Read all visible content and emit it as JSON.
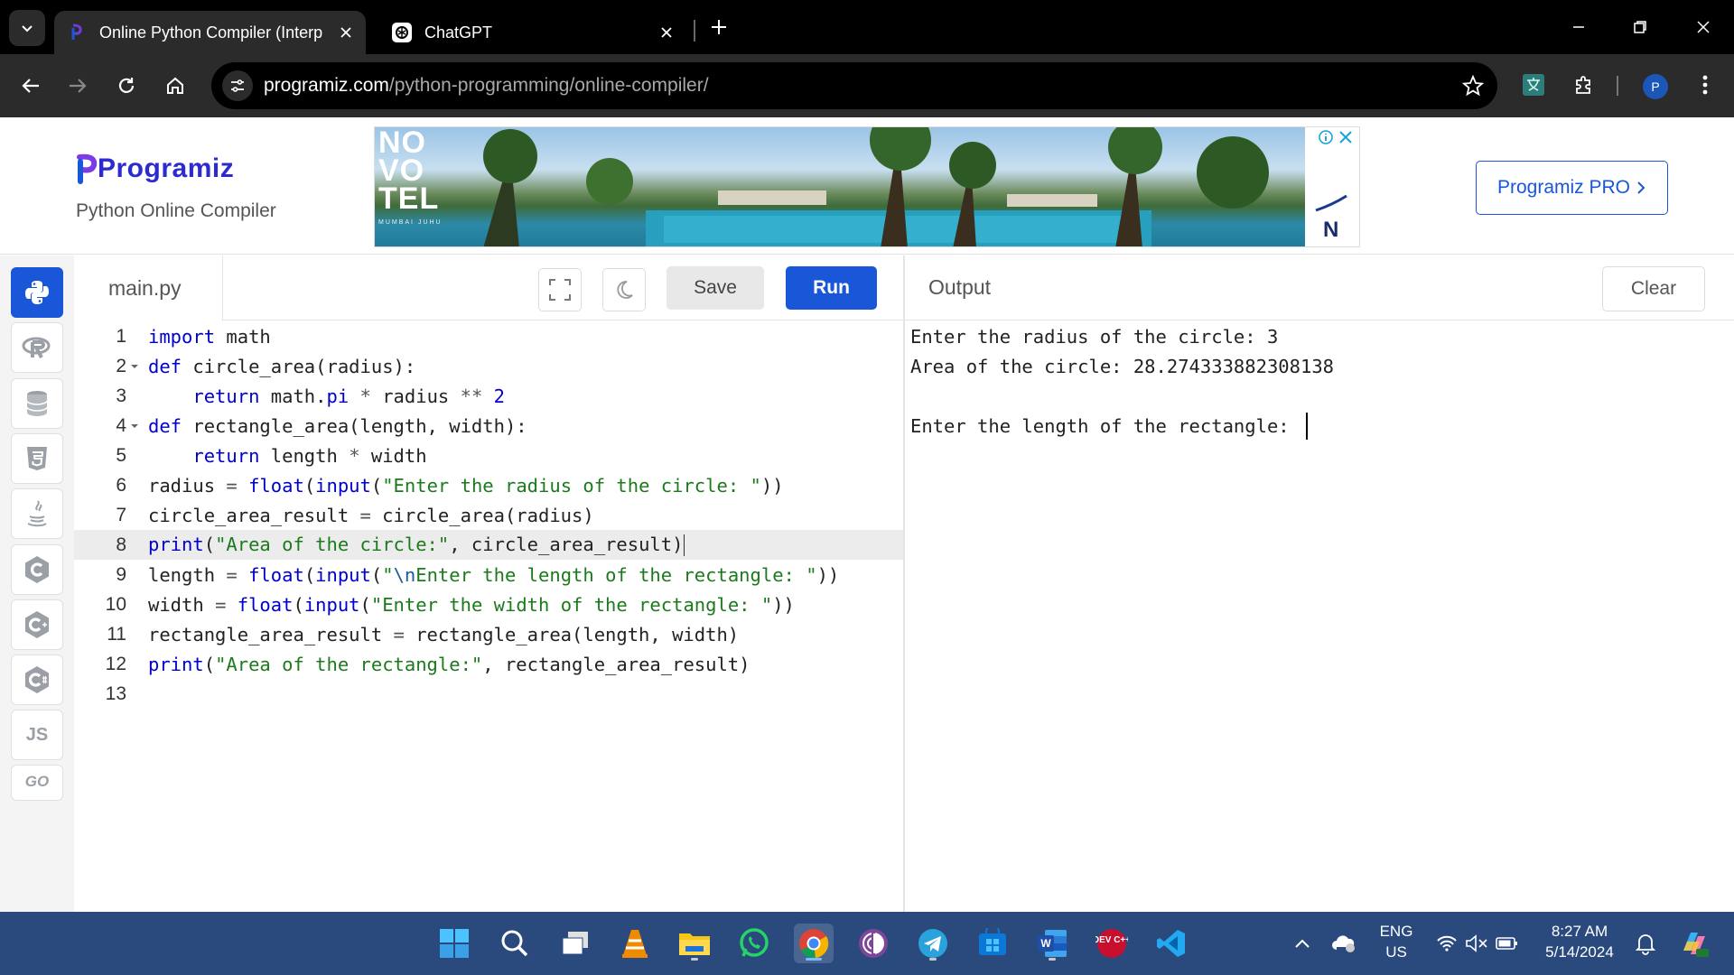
{
  "browser": {
    "tabs": [
      {
        "title": "Online Python Compiler (Interp",
        "active": true
      },
      {
        "title": "ChatGPT",
        "active": false
      }
    ],
    "url_domain": "programiz.com",
    "url_path": "/python-programming/online-compiler/",
    "profile_initial": "P"
  },
  "site": {
    "logo": "Programiz",
    "subtitle": "Python Online Compiler",
    "pro_button": "Programiz PRO",
    "ad": {
      "brand": "NO VO TEL",
      "small": "MUMBAI JUHU",
      "corner_letter": "N"
    }
  },
  "sidebar": {
    "languages": [
      {
        "name": "python-icon",
        "active": true,
        "label": ""
      },
      {
        "name": "r-icon",
        "active": false,
        "label": ""
      },
      {
        "name": "sql-icon",
        "active": false,
        "label": ""
      },
      {
        "name": "html-icon",
        "active": false,
        "label": ""
      },
      {
        "name": "java-icon",
        "active": false,
        "label": ""
      },
      {
        "name": "c-icon",
        "active": false,
        "label": ""
      },
      {
        "name": "cpp-icon",
        "active": false,
        "label": ""
      },
      {
        "name": "csharp-icon",
        "active": false,
        "label": ""
      },
      {
        "name": "js-icon",
        "active": false,
        "label": "JS"
      },
      {
        "name": "go-icon",
        "active": false,
        "label": "GO"
      }
    ]
  },
  "editor": {
    "filename": "main.py",
    "save_label": "Save",
    "run_label": "Run",
    "current_line": 8,
    "lines": [
      {
        "n": "1",
        "fold": false,
        "html": "<span class=\"kw\">import</span> math"
      },
      {
        "n": "2",
        "fold": true,
        "html": "<span class=\"kw\">def</span> circle_area(radius):"
      },
      {
        "n": "3",
        "fold": false,
        "html": "    <span class=\"kw\">return</span> math.<span class=\"kw\">pi</span> <span class=\"op\">*</span> radius <span class=\"op\">**</span> <span class=\"num\">2</span>"
      },
      {
        "n": "4",
        "fold": true,
        "html": "<span class=\"kw\">def</span> rectangle_area(length, width):"
      },
      {
        "n": "5",
        "fold": false,
        "html": "    <span class=\"kw\">return</span> length <span class=\"op\">*</span> width"
      },
      {
        "n": "6",
        "fold": false,
        "html": "radius <span class=\"op\">=</span> <span class=\"kw\">float</span>(<span class=\"kw\">input</span>(<span class=\"str\">\"Enter the radius of the circle: \"</span>))"
      },
      {
        "n": "7",
        "fold": false,
        "html": "circle_area_result <span class=\"op\">=</span> circle_area(radius)"
      },
      {
        "n": "8",
        "fold": false,
        "html": "<span class=\"kw\">print</span>(<span class=\"str\">\"Area of the circle:\"</span>, circle_area_result)"
      },
      {
        "n": "9",
        "fold": false,
        "html": "length <span class=\"op\">=</span> <span class=\"kw\">float</span>(<span class=\"kw\">input</span>(<span class=\"str\">\"<span class=\"esc\">\\n</span>Enter the length of the rectangle: \"</span>))"
      },
      {
        "n": "10",
        "fold": false,
        "html": "width <span class=\"op\">=</span> <span class=\"kw\">float</span>(<span class=\"kw\">input</span>(<span class=\"str\">\"Enter the width of the rectangle: \"</span>))"
      },
      {
        "n": "11",
        "fold": false,
        "html": "rectangle_area_result <span class=\"op\">=</span> rectangle_area(length, width)"
      },
      {
        "n": "12",
        "fold": false,
        "html": "<span class=\"kw\">print</span>(<span class=\"str\">\"Area of the rectangle:\"</span>, rectangle_area_result)"
      },
      {
        "n": "13",
        "fold": false,
        "html": ""
      }
    ]
  },
  "output": {
    "title": "Output",
    "clear_label": "Clear",
    "lines": [
      "Enter the radius of the circle: 3",
      "Area of the circle: 28.274333882308138",
      "",
      "Enter the length of the rectangle: "
    ]
  },
  "taskbar": {
    "apps": [
      "windows-start-icon",
      "search-icon",
      "task-view-icon",
      "vlc-icon",
      "file-explorer-icon",
      "whatsapp-icon",
      "chrome-icon",
      "tor-browser-icon",
      "telegram-icon",
      "windows-store-icon",
      "word-icon",
      "dev-cpp-icon",
      "vscode-icon"
    ],
    "language": "ENG",
    "region": "US",
    "time": "8:27 AM",
    "date": "5/14/2024",
    "dev_label": "DEV C++",
    "word_label": "W"
  },
  "colors": {
    "accent": "#1a57d8",
    "logo": "#2b2bd0",
    "keyword": "#0000cd",
    "string": "#1c7a1c",
    "taskbar": "#2a4a7e"
  }
}
